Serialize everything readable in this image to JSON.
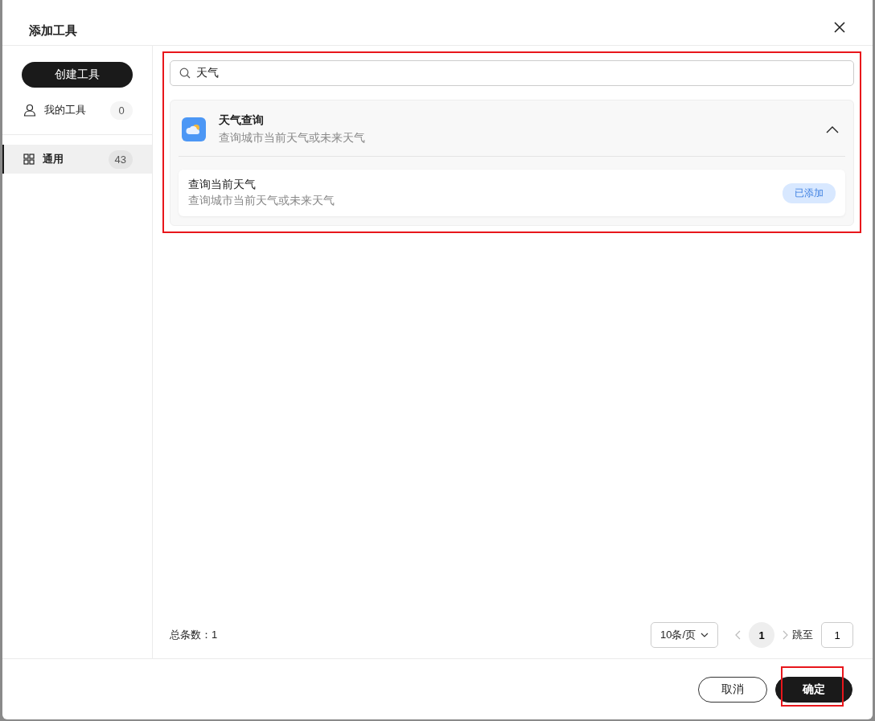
{
  "dialog": {
    "title": "添加工具"
  },
  "sidebar": {
    "create_button": "创建工具",
    "items": [
      {
        "label": "我的工具",
        "count": "0",
        "selected": false,
        "kind": "user"
      },
      {
        "label": "通用",
        "count": "43",
        "selected": true,
        "kind": "grid"
      }
    ]
  },
  "search": {
    "value": "天气"
  },
  "results_highlighted": true,
  "groups": [
    {
      "title": "天气查询",
      "description": "查询城市当前天气或未来天气",
      "expanded": true,
      "tools": [
        {
          "name": "查询当前天气",
          "description": "查询城市当前天气或未来天气",
          "status": "已添加"
        }
      ]
    }
  ],
  "pagination": {
    "total_label": "总条数：1",
    "page_size": "10条/页",
    "pages": [
      {
        "label": "1",
        "selected": true
      }
    ],
    "jump_label": "跳至",
    "jump_value": "1"
  },
  "buttons": [
    {
      "label": "取消",
      "kind": "secondary",
      "highlighted": false
    },
    {
      "label": "确定",
      "kind": "primary",
      "highlighted": true
    }
  ]
}
